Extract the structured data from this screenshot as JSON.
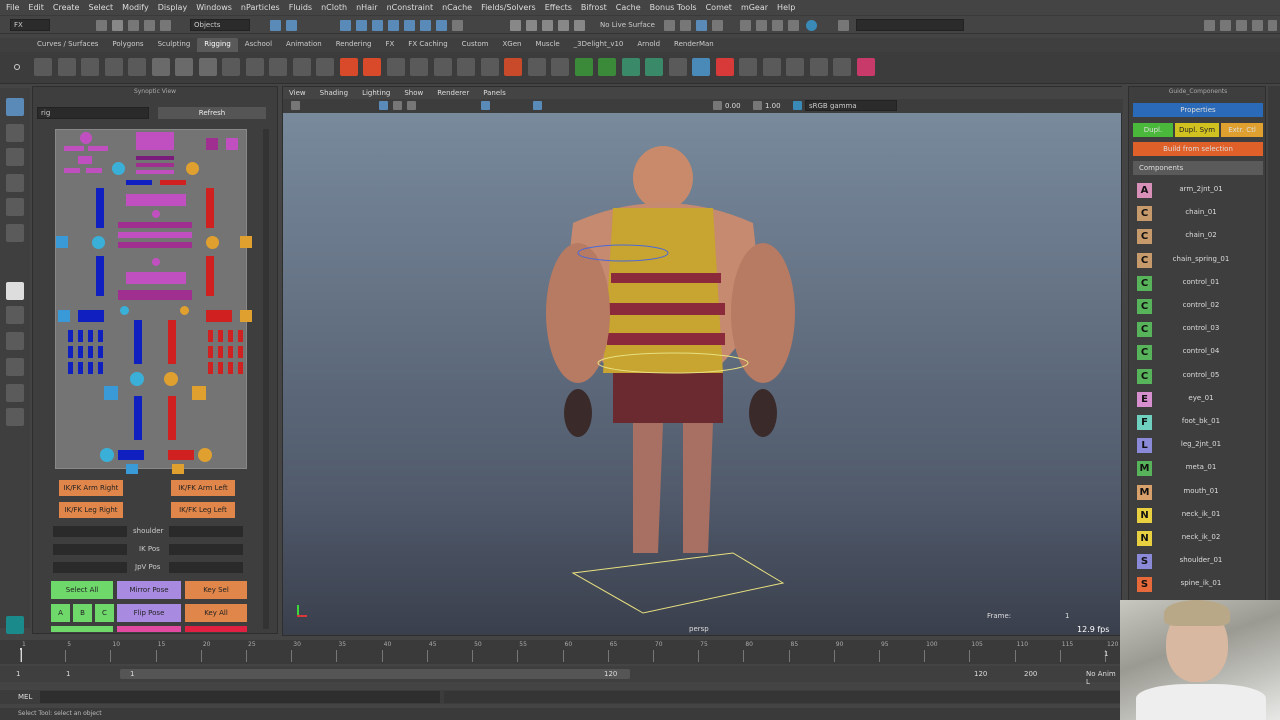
{
  "menu": [
    "File",
    "Edit",
    "Create",
    "Select",
    "Modify",
    "Display",
    "Windows",
    "nParticles",
    "Fluids",
    "nCloth",
    "nHair",
    "nConstraint",
    "nCache",
    "Fields/Solvers",
    "Effects",
    "Bifrost",
    "Cache",
    "Bonus Tools",
    "Comet",
    "mGear",
    "Help"
  ],
  "status": {
    "mode": "FX",
    "objects": "Objects",
    "no_live": "No Live Surface"
  },
  "shelf_tabs": [
    "Curves / Surfaces",
    "Polygons",
    "Sculpting",
    "Rigging",
    "Aschool",
    "Animation",
    "Rendering",
    "FX",
    "FX Caching",
    "Custom",
    "XGen",
    "Muscle",
    "_3Delight_v10",
    "Arnold",
    "RenderMan"
  ],
  "active_shelf": "Rigging",
  "synoptic": {
    "title": "Synoptic View",
    "rig": "rig",
    "refresh": "Refresh",
    "ikfk_arm_right": "IK/FK Arm Right",
    "ikfk_arm_left": "IK/FK Arm Left",
    "ikfk_leg_right": "IK/FK Leg Right",
    "ikfk_leg_left": "IK/FK Leg Left",
    "shoulder": "shoulder",
    "ik_pos": "IK Pos",
    "jpv_pos": "JpV Pos",
    "select_all": "Select All",
    "mirror_pose": "Mirror Pose",
    "key_sel": "Key Sel",
    "flip_pose": "Flip Pose",
    "key_all": "Key All",
    "a": "A",
    "b": "B",
    "c": "C"
  },
  "viewport": {
    "menu": [
      "View",
      "Shading",
      "Lighting",
      "Show",
      "Renderer",
      "Panels"
    ],
    "exposure": "0.00",
    "gamma": "1.00",
    "color_space": "sRGB gamma",
    "camera": "persp",
    "frame_label": "Frame:",
    "frame": "1",
    "fps": "12.9 fps"
  },
  "guide": {
    "title": "Guide_Components",
    "properties": "Properties",
    "dupl": "Dupl.",
    "dupl_sym": "Dupl. Sym",
    "extr_ctl": "Extr. Ctl",
    "build": "Build from selection",
    "components_header": "Components",
    "items": [
      {
        "letter": "A",
        "name": "arm_2jnt_01",
        "color": "#d88fb8"
      },
      {
        "letter": "C",
        "name": "chain_01",
        "color": "#c69a6a"
      },
      {
        "letter": "C",
        "name": "chain_02",
        "color": "#c69a6a"
      },
      {
        "letter": "C",
        "name": "chain_spring_01",
        "color": "#c69a6a"
      },
      {
        "letter": "C",
        "name": "control_01",
        "color": "#58b45a"
      },
      {
        "letter": "C",
        "name": "control_02",
        "color": "#58b45a"
      },
      {
        "letter": "C",
        "name": "control_03",
        "color": "#58b45a"
      },
      {
        "letter": "C",
        "name": "control_04",
        "color": "#58b45a"
      },
      {
        "letter": "C",
        "name": "control_05",
        "color": "#58b45a"
      },
      {
        "letter": "E",
        "name": "eye_01",
        "color": "#d88fd0"
      },
      {
        "letter": "F",
        "name": "foot_bk_01",
        "color": "#6fd0c0"
      },
      {
        "letter": "L",
        "name": "leg_2jnt_01",
        "color": "#8a8ad8"
      },
      {
        "letter": "M",
        "name": "meta_01",
        "color": "#58b45a"
      },
      {
        "letter": "M",
        "name": "mouth_01",
        "color": "#d8a06a"
      },
      {
        "letter": "N",
        "name": "neck_ik_01",
        "color": "#e8d040"
      },
      {
        "letter": "N",
        "name": "neck_ik_02",
        "color": "#e8d040"
      },
      {
        "letter": "S",
        "name": "shoulder_01",
        "color": "#8a8ad8"
      },
      {
        "letter": "S",
        "name": "spine_ik_01",
        "color": "#e86a3a"
      }
    ]
  },
  "timeline": {
    "ticks": [
      "1",
      "5",
      "10",
      "15",
      "20",
      "25",
      "30",
      "35",
      "40",
      "45",
      "50",
      "55",
      "60",
      "65",
      "70",
      "75",
      "80",
      "85",
      "90",
      "95",
      "100",
      "105",
      "110",
      "115",
      "120"
    ],
    "current": "1",
    "range_start": "1",
    "range_inner_start": "1",
    "range_inner_end": "120",
    "range_end": "120",
    "anim_end": "200",
    "anim_layer": "No Anim L"
  },
  "cmd": {
    "lang": "MEL"
  },
  "help": "Select Tool: select an object"
}
